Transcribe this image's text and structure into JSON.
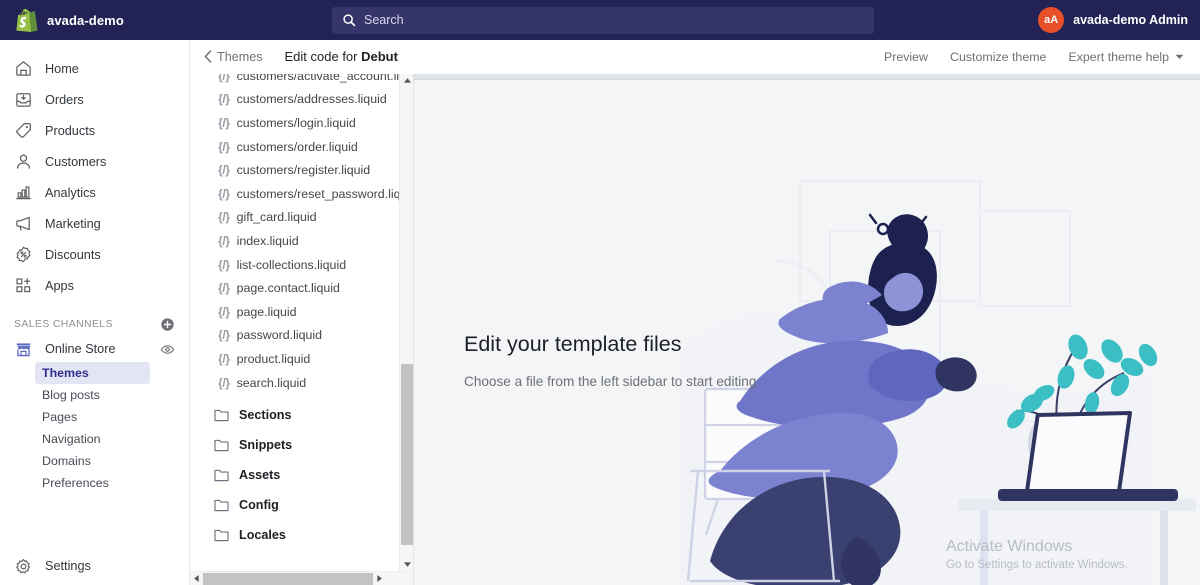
{
  "topbar": {
    "brand_name": "avada-demo",
    "logo_icon": "shopify-bag-icon",
    "search": {
      "icon": "search-icon",
      "placeholder": "Search",
      "value": ""
    },
    "user": {
      "avatar_initials": "aA",
      "name": "avada-demo Admin",
      "avatar_color": "#e8502a"
    }
  },
  "sidebar": {
    "items": [
      {
        "label": "Home",
        "icon": "home-icon"
      },
      {
        "label": "Orders",
        "icon": "orders-inbox-icon"
      },
      {
        "label": "Products",
        "icon": "products-tag-icon"
      },
      {
        "label": "Customers",
        "icon": "customers-person-icon"
      },
      {
        "label": "Analytics",
        "icon": "analytics-bar-chart-icon"
      },
      {
        "label": "Marketing",
        "icon": "marketing-megaphone-icon"
      },
      {
        "label": "Discounts",
        "icon": "discounts-percent-icon"
      },
      {
        "label": "Apps",
        "icon": "apps-grid-plus-icon"
      }
    ],
    "sales_channels": {
      "title": "SALES CHANNELS",
      "add_icon": "plus-circle-icon",
      "channel": {
        "label": "Online Store",
        "icon": "storefront-icon",
        "view_icon": "eye-icon"
      },
      "sub_items": [
        {
          "label": "Themes",
          "active": true
        },
        {
          "label": "Blog posts",
          "active": false
        },
        {
          "label": "Pages",
          "active": false
        },
        {
          "label": "Navigation",
          "active": false
        },
        {
          "label": "Domains",
          "active": false
        },
        {
          "label": "Preferences",
          "active": false
        }
      ]
    },
    "settings": {
      "label": "Settings",
      "icon": "gear-icon"
    }
  },
  "header": {
    "back_icon": "chevron-left-icon",
    "back_label": "Themes",
    "title_prefix": "Edit code for ",
    "title_theme": "Debut",
    "actions": [
      {
        "label": "Preview",
        "caret": false
      },
      {
        "label": "Customize theme",
        "caret": false
      },
      {
        "label": "Expert theme help",
        "caret": true
      }
    ]
  },
  "file_tree": {
    "file_icon": "{/}",
    "files": [
      "customers/activate_account.li",
      "customers/addresses.liquid",
      "customers/login.liquid",
      "customers/order.liquid",
      "customers/register.liquid",
      "customers/reset_password.liq",
      "gift_card.liquid",
      "index.liquid",
      "list-collections.liquid",
      "page.contact.liquid",
      "page.liquid",
      "password.liquid",
      "product.liquid",
      "search.liquid"
    ],
    "folders": [
      {
        "label": "Sections",
        "icon": "folder-icon"
      },
      {
        "label": "Snippets",
        "icon": "folder-icon"
      },
      {
        "label": "Assets",
        "icon": "folder-icon"
      },
      {
        "label": "Config",
        "icon": "folder-icon"
      },
      {
        "label": "Locales",
        "icon": "folder-icon"
      }
    ]
  },
  "editor": {
    "expand_icon": "expand-fullscreen-icon",
    "empty_state": {
      "title": "Edit your template files",
      "subtitle": "Choose a file from the left sidebar to start editing",
      "illustration": "person-at-desk-with-laptop-illustration"
    }
  },
  "watermark": {
    "title": "Activate Windows",
    "subtitle": "Go to Settings to activate Windows."
  }
}
